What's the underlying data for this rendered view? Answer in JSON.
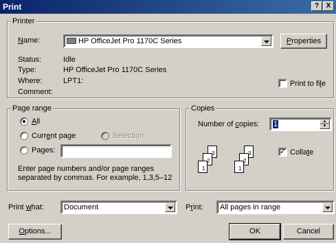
{
  "window": {
    "title": "Print",
    "help_label": "?",
    "close_label": "X"
  },
  "printer": {
    "legend": "Printer",
    "name_label": "Name:",
    "name_value": "HP OfficeJet Pro 1170C Series",
    "properties_label": "Properties",
    "status_label": "Status:",
    "status_value": "Idle",
    "type_label": "Type:",
    "type_value": "HP OfficeJet Pro 1170C Series",
    "where_label": "Where:",
    "where_value": "LPT1:",
    "comment_label": "Comment:",
    "print_to_file_label": "Print to file",
    "print_to_file_checked": false
  },
  "page_range": {
    "legend": "Page range",
    "all_label": "All",
    "current_page_label": "Current page",
    "selection_label": "Selection",
    "pages_label": "Pages:",
    "pages_value": "",
    "selected": "All",
    "hint": "Enter page numbers and/or page ranges separated by commas.  For example, 1,3,5–12"
  },
  "copies": {
    "legend": "Copies",
    "number_label": "Number of copies:",
    "number_value": "1",
    "collate_label": "Collate",
    "collate_checked": true,
    "page_numbers": [
      "3",
      "2",
      "1",
      "3",
      "2",
      "1"
    ]
  },
  "bottom": {
    "print_what_label": "Print what:",
    "print_what_value": "Document",
    "print_label": "Print:",
    "print_value": "All pages in range",
    "options_label": "Options...",
    "ok_label": "OK",
    "cancel_label": "Cancel"
  }
}
